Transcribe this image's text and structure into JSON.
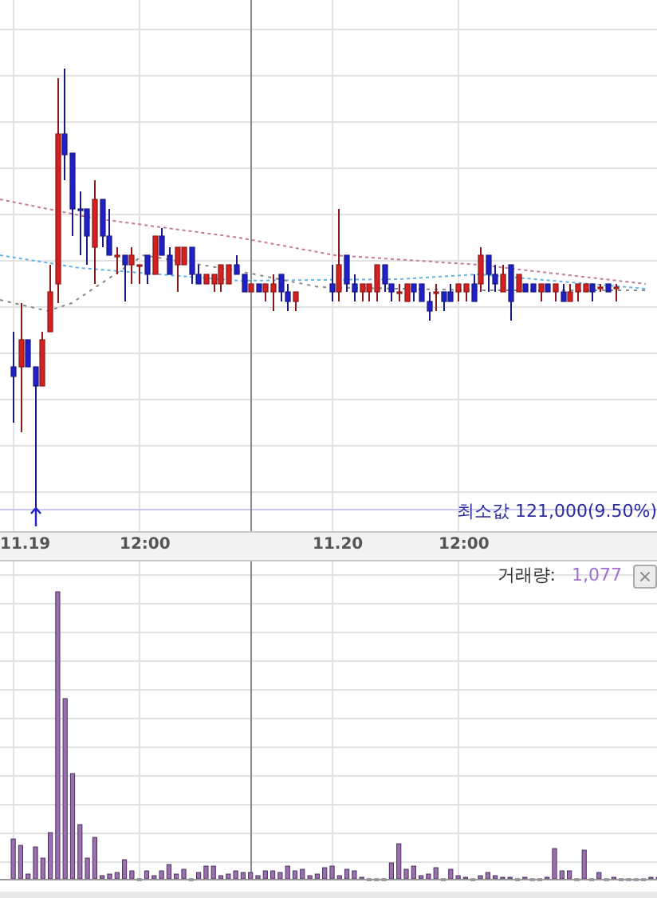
{
  "price_panel": {
    "min_marker": "최소값 121,000(9.50%)"
  },
  "time_axis": {
    "labels": [
      "11.19",
      "12:00",
      "11.20",
      "12:00"
    ]
  },
  "volume_panel": {
    "label": "거래량:",
    "value": "1,077",
    "close": "×"
  }
}
